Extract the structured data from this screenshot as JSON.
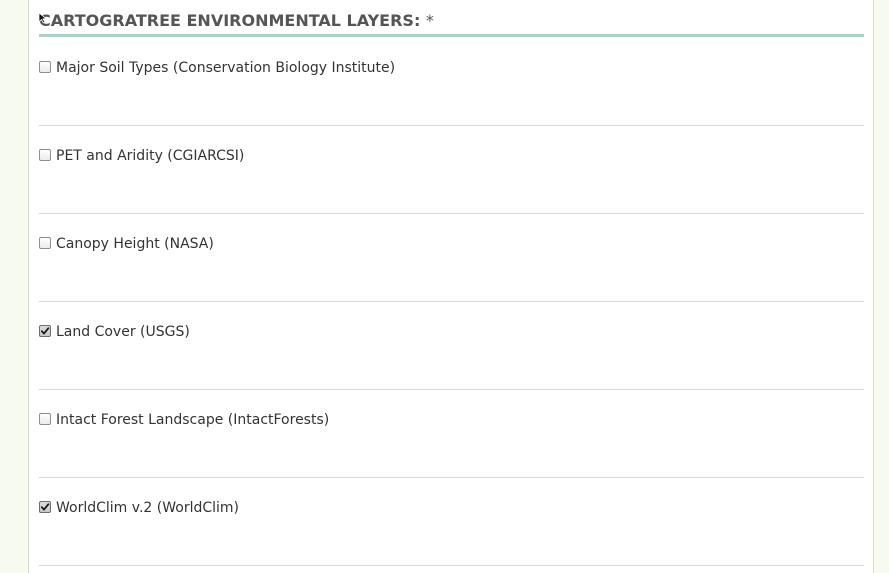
{
  "section": {
    "title": "CARTOGRATREE ENVIRONMENTAL LAYERS:",
    "required_marker": "*"
  },
  "layers": [
    {
      "label": "Major Soil Types (Conservation Biology Institute)",
      "checked": false
    },
    {
      "label": "PET and Aridity (CGIARCSI)",
      "checked": false
    },
    {
      "label": "Canopy Height (NASA)",
      "checked": false
    },
    {
      "label": "Land Cover (USGS)",
      "checked": true
    },
    {
      "label": "Intact Forest Landscape (IntactForests)",
      "checked": false
    },
    {
      "label": "WorldClim v.2 (WorldClim)",
      "checked": true
    }
  ],
  "colors": {
    "page_background": "#f7fbef",
    "title_underline": "#a8d4c8",
    "row_divider": "#d9d9d9",
    "text": "#333333"
  }
}
